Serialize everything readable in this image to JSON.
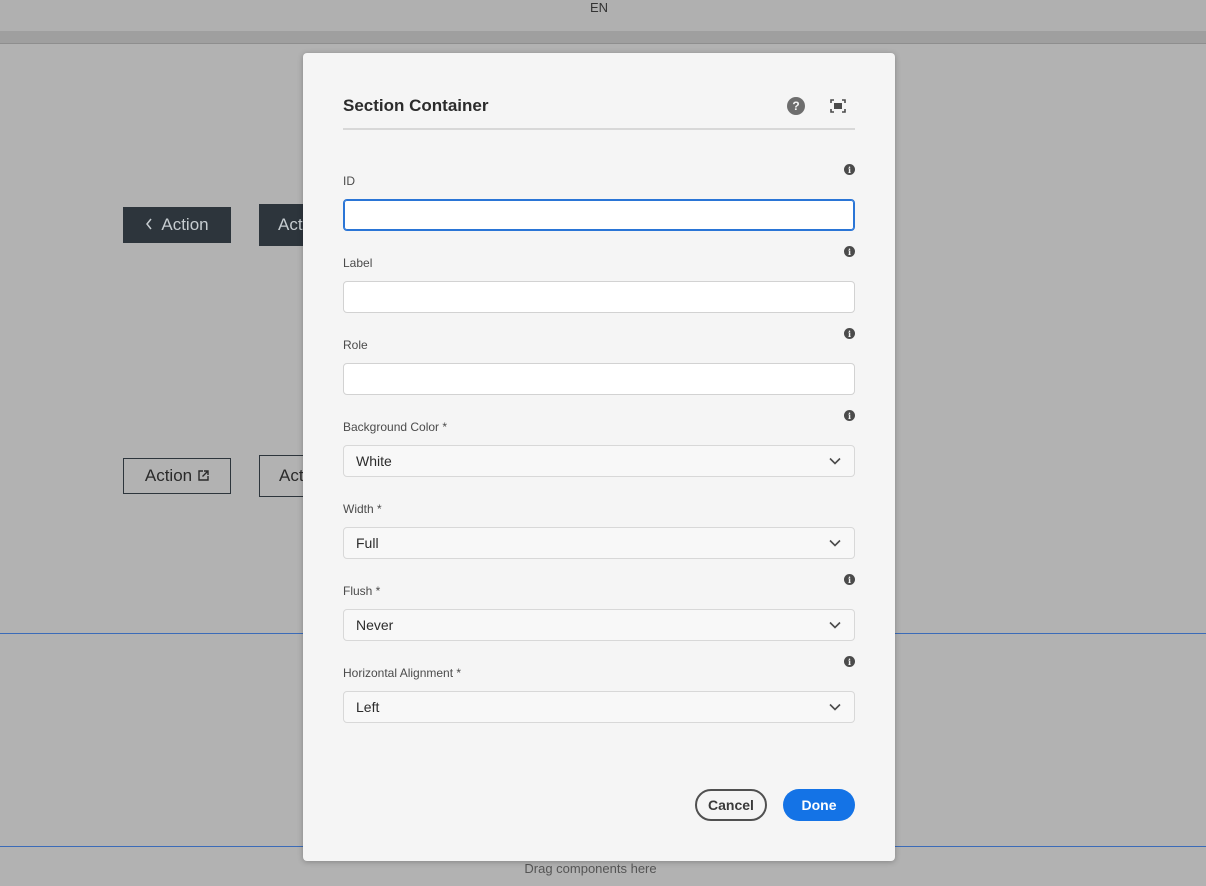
{
  "background": {
    "language": "EN",
    "buttons": {
      "dark_back": "Action",
      "dark_second": "Act",
      "outline_external": "Action",
      "outline_second": "Act"
    },
    "drop_zone_text": "Drag components here"
  },
  "dialog": {
    "title": "Section Container",
    "fields": {
      "id": {
        "label": "ID",
        "value": ""
      },
      "label": {
        "label": "Label",
        "value": ""
      },
      "role": {
        "label": "Role",
        "value": ""
      },
      "background_color": {
        "label": "Background Color *",
        "value": "White"
      },
      "width": {
        "label": "Width *",
        "value": "Full"
      },
      "flush": {
        "label": "Flush *",
        "value": "Never"
      },
      "horizontal_alignment": {
        "label": "Horizontal Alignment *",
        "value": "Left"
      }
    },
    "buttons": {
      "cancel": "Cancel",
      "done": "Done"
    }
  },
  "colors": {
    "accent": "#1473e6",
    "focus": "#2a75d6",
    "dark_button": "#2d353c"
  }
}
